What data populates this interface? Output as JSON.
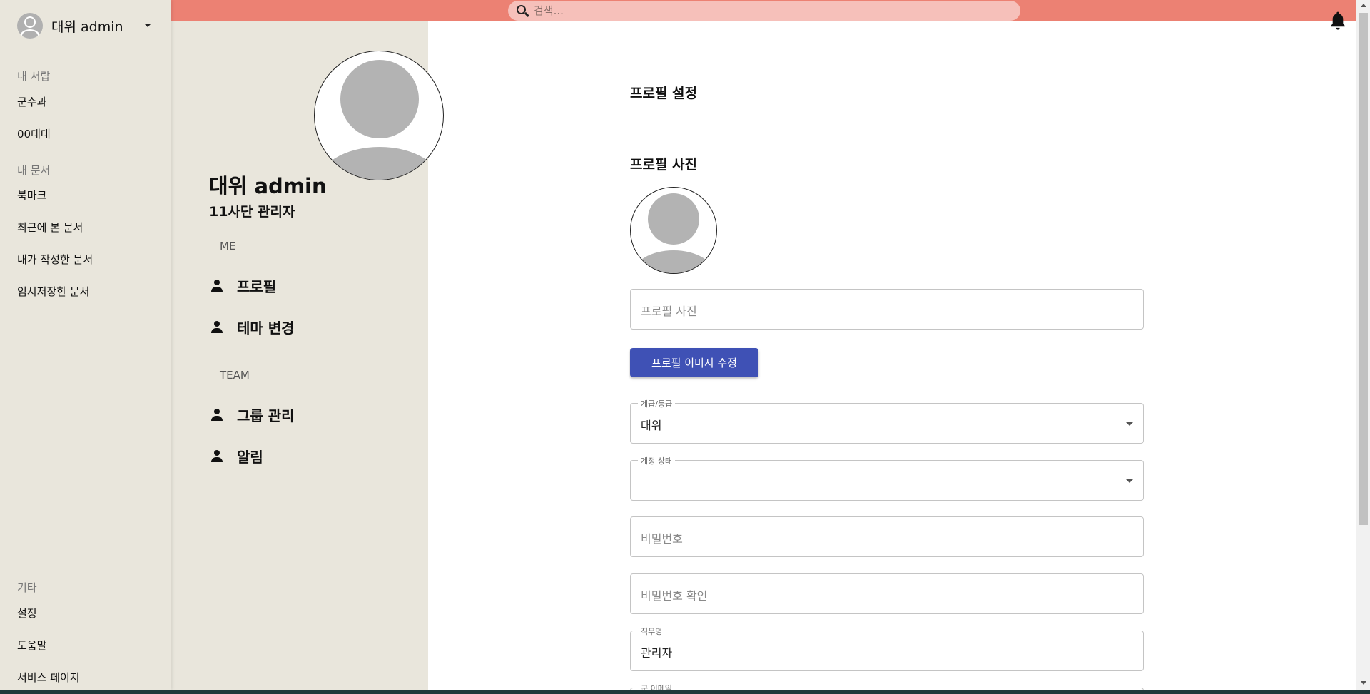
{
  "user_menu": {
    "name": "대위 admin"
  },
  "sidebar": {
    "sections": [
      {
        "title": "내 서랍",
        "items": [
          "군수과",
          "00대대"
        ]
      },
      {
        "title": "내 문서",
        "items": [
          "북마크",
          "최근에 본 문서",
          "내가 작성한 문서",
          "임시저장한 문서"
        ]
      },
      {
        "title": "기타",
        "items": [
          "설정",
          "도움말",
          "서비스 페이지"
        ]
      }
    ]
  },
  "search": {
    "placeholder": "검색..."
  },
  "profile": {
    "name": "대위 admin",
    "role": "11사단 관리자",
    "me_section": "ME",
    "me_items": [
      "프로필",
      "테마 변경"
    ],
    "team_section": "TEAM",
    "team_items": [
      "그룹 관리",
      "알림"
    ]
  },
  "main": {
    "title": "프로필 설정",
    "photo_title": "프로필 사진",
    "photo_placeholder": "프로필 사진",
    "edit_button": "프로필 이미지 수정",
    "rank_label": "계급/등급",
    "rank_value": "대위",
    "status_label": "계정 상태",
    "status_value": "",
    "password_placeholder": "비밀번호",
    "password_confirm_placeholder": "비밀번호 확인",
    "duty_label": "직무명",
    "duty_value": "관리자",
    "email_label": "군 이메일"
  },
  "colors": {
    "topbar": "#ec8173",
    "search_bg": "#f6c0ba",
    "sidebar_bg": "#e9e6dc",
    "primary": "#3f51b5"
  }
}
